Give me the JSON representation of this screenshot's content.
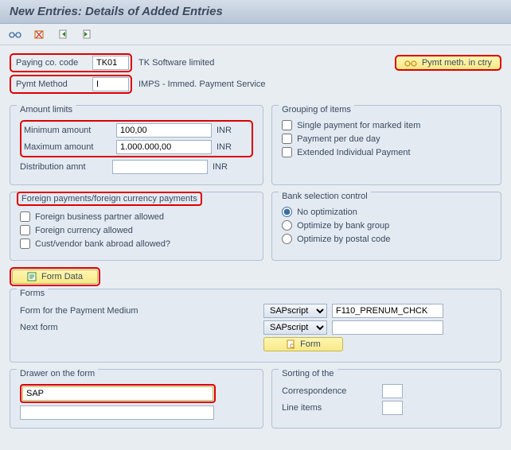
{
  "title": "New Entries: Details of Added Entries",
  "header": {
    "paying_code_label": "Paying co. code",
    "paying_code_value": "TK01",
    "paying_code_desc": "TK Software limited",
    "pymt_method_label": "Pymt Method",
    "pymt_method_value": "I",
    "pymt_method_desc": "IMPS - Immed. Payment Service",
    "pymt_meth_btn": "Pymt meth. in ctry"
  },
  "amount_limits": {
    "title": "Amount limits",
    "min_label": "Minimum amount",
    "min_value": "100,00",
    "max_label": "Maximum amount",
    "max_value": "1.000.000,00",
    "dist_label": "Distribution amnt",
    "dist_value": "",
    "currency": "INR"
  },
  "grouping": {
    "title": "Grouping of items",
    "single_payment": "Single payment for marked item",
    "per_due_day": "Payment per due day",
    "extended": "Extended Individual Payment"
  },
  "foreign": {
    "title": "Foreign payments/foreign currency payments",
    "fbp": "Foreign business partner allowed",
    "fca": "Foreign currency allowed",
    "cvba": "Cust/vendor bank abroad allowed?"
  },
  "bank_selection": {
    "title": "Bank selection control",
    "no_opt": "No optimization",
    "by_group": "Optimize by bank group",
    "by_postal": "Optimize by postal code"
  },
  "form_data_btn": "Form Data",
  "forms": {
    "title": "Forms",
    "form_medium_label": "Form for the Payment Medium",
    "next_form_label": "Next form",
    "script_option": "SAPscript",
    "form_value": "F110_PRENUM_CHCK",
    "next_form_value": "",
    "form_btn": "Form"
  },
  "drawer": {
    "title": "Drawer on the form",
    "line1": "SAP",
    "line2": ""
  },
  "sorting": {
    "title": "Sorting of the",
    "corr_label": "Correspondence",
    "corr_value": "",
    "line_items_label": "Line items",
    "line_items_value": ""
  }
}
